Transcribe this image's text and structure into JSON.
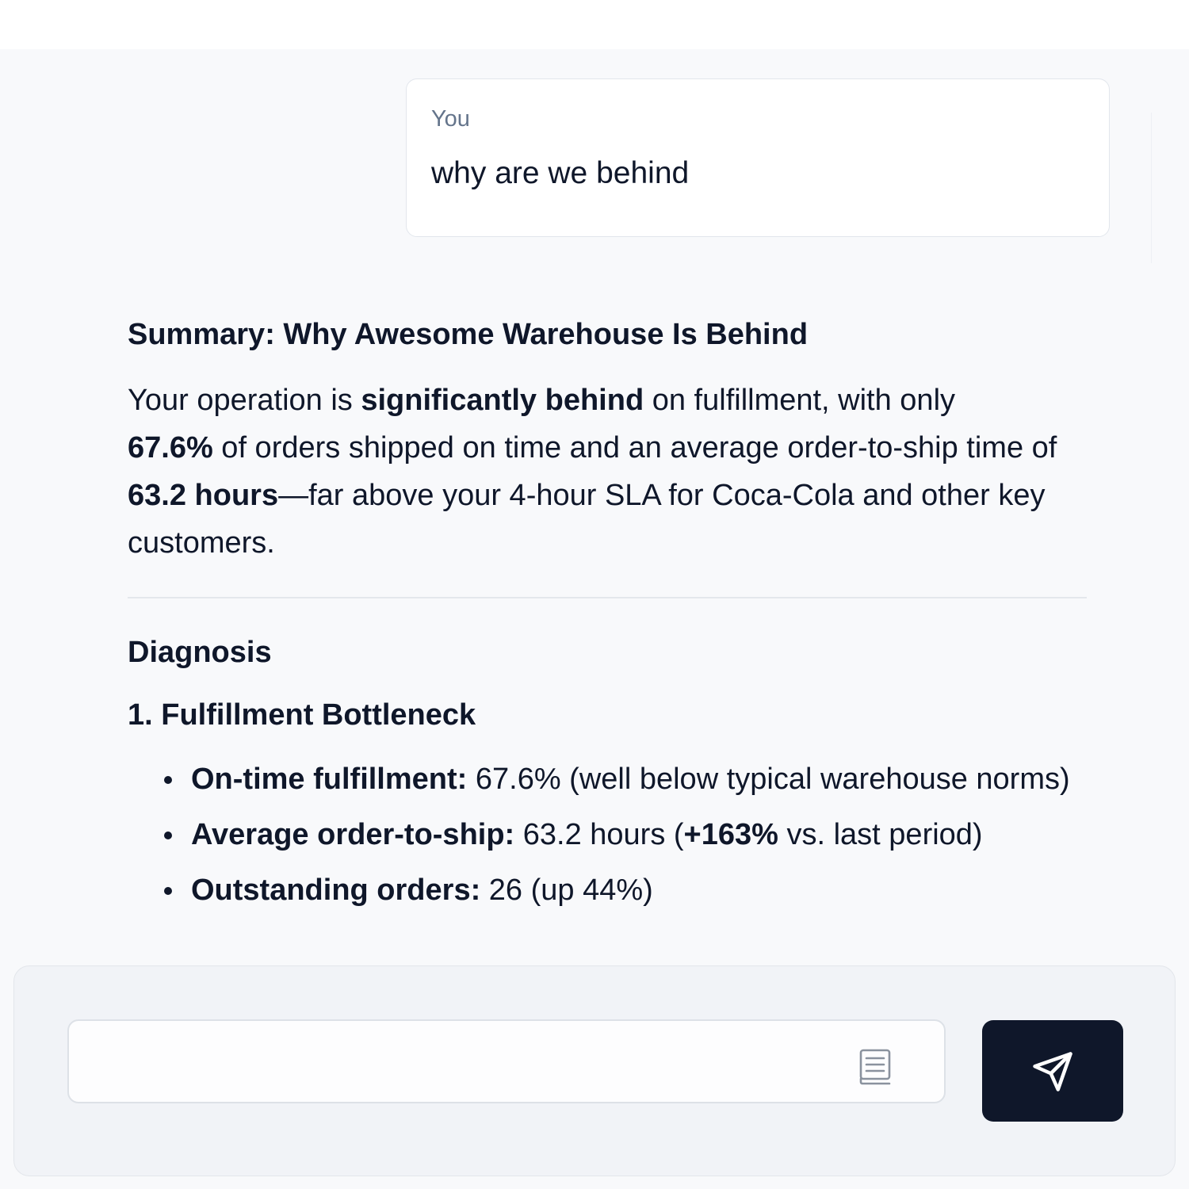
{
  "conversation": {
    "user_message": {
      "label": "You",
      "text": "why are we behind"
    },
    "assistant_message": {
      "title": "Summary: Why Awesome Warehouse Is Behind",
      "paragraph": {
        "t1": "Your operation is ",
        "b1": "significantly behind",
        "t2": " on fulfillment, with only ",
        "b2": "67.6%",
        "t3": " of orders shipped on time and an average order-to-ship time of ",
        "b3": "63.2 hours",
        "t4": "—far above your 4-hour SLA for Coca-Cola and other key customers."
      },
      "diagnosis_heading": "Diagnosis",
      "subheading": "1. Fulfillment Bottleneck",
      "bullets": [
        {
          "label": "On-time fulfillment:",
          "text": " 67.6% (well below typical warehouse norms)"
        },
        {
          "label": "Average order-to-ship:",
          "text_before": " 63.2 hours (",
          "bold": "+163%",
          "text_after": " vs. last period)"
        },
        {
          "label": "Outstanding orders:",
          "text": " 26 (up 44%)"
        }
      ]
    }
  },
  "composer": {
    "placeholder": "",
    "value": "",
    "icons": {
      "attachment": "book-icon",
      "send": "paper-plane-icon"
    }
  },
  "colors": {
    "page_background": "#f8f9fb",
    "text_primary": "#0f172a",
    "text_muted": "#64748b",
    "send_button": "#0f172a",
    "composer_background": "#f1f3f7"
  }
}
